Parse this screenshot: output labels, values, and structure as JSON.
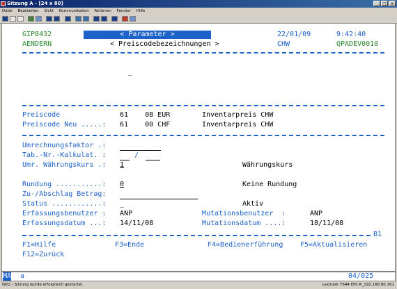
{
  "window": {
    "title": "Sitzung A - [24 x 80]",
    "min": "_",
    "max": "□",
    "close": "x"
  },
  "menu": [
    "Datei",
    "Bearbeiten",
    "Sicht",
    "Kommunikation",
    "Aktionen",
    "Fenster",
    "Hilfe"
  ],
  "screen": {
    "sys_id": "GIP8432",
    "mode": "AENDERN",
    "header_title": "< Parameter >",
    "subtitle": "< Preiscodebezeichnungen >",
    "date": "22/01/09",
    "time": "9:42:40",
    "user": "CHW",
    "program": "QPADEV0010",
    "cursor_mark": "_",
    "preiscode_label": "Preiscode",
    "preiscode_value": "61    08 EUR",
    "preiscode_text": "Inventarpreis CHW",
    "preiscode_neu_label": "Preiscode Neu .....:",
    "preiscode_neu_value": "61    00 CHF",
    "preiscode_neu_text": "Inventarpreis CHW",
    "umrechnung_label": "Umrechnungsfaktor .:",
    "tab_label": "Tab.-Nr.-Kalkulat. :",
    "tab_sep": "/",
    "umr_label": "Umr. Währungskurs .:",
    "umr_value": "1",
    "umr_text": "Währungskurs",
    "rundung_label": "Rundung ...........:",
    "rundung_value": "0",
    "rundung_text": "Keine Rundung",
    "zuab_label": "Zu-/Abschlag Betrag:",
    "status_label": "Status ............:",
    "status_value": "_",
    "status_text": "Aktiv",
    "erf_benutzer_label": "Erfassungsbenutzer :",
    "erf_benutzer_value": "ANP",
    "mut_benutzer_label": "Mutationsbenutzer  :",
    "mut_benutzer_value": "ANP",
    "erf_datum_label": "Erfassungsdatum ...:",
    "erf_datum_value": "14/11/08",
    "mut_datum_label": "Mutationsdatum ....:",
    "mut_datum_value": "18/11/08",
    "b1": "B1",
    "f1": "F1=Hilfe",
    "f3": "F3=Ende",
    "f4": "F4=Bedienerführung",
    "f5": "F5=Aktualisieren",
    "f12": "F12=Zurück"
  },
  "status": {
    "indicator": "MA",
    "mode_char": "a",
    "position": "04/025"
  },
  "bottom": {
    "message": "I902 - Sitzung wurde erfolgreich gestartet.",
    "right": "Lexmark T644 EIN IP_192.168.80.161"
  },
  "colors": {
    "field_blue": "#1c62c9",
    "text_green": "#2a8a2a",
    "title_bar": "#0a246a"
  }
}
